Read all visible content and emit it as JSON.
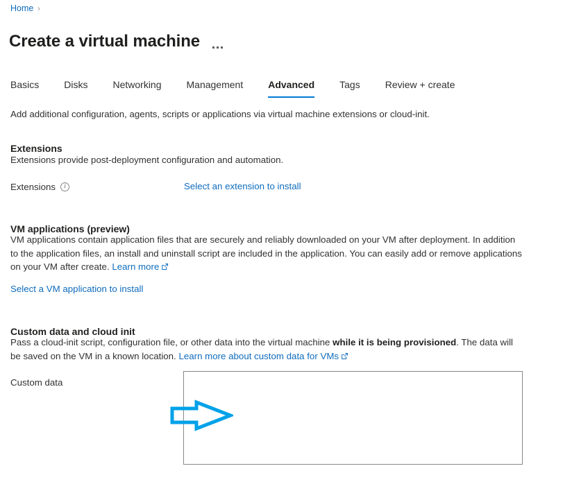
{
  "breadcrumb": {
    "home_label": "Home",
    "separator": "›"
  },
  "header": {
    "title": "Create a virtual machine",
    "more_menu_label": "..."
  },
  "tabs": [
    {
      "label": "Basics",
      "active": false
    },
    {
      "label": "Disks",
      "active": false
    },
    {
      "label": "Networking",
      "active": false
    },
    {
      "label": "Management",
      "active": false
    },
    {
      "label": "Advanced",
      "active": true
    },
    {
      "label": "Tags",
      "active": false
    },
    {
      "label": "Review + create",
      "active": false
    }
  ],
  "main": {
    "intro": "Add additional configuration, agents, scripts or applications via virtual machine extensions or cloud-init.",
    "extensions": {
      "heading": "Extensions",
      "description": "Extensions provide post-deployment configuration and automation.",
      "field_label": "Extensions",
      "info_glyph": "i",
      "select_link": "Select an extension to install"
    },
    "vm_applications": {
      "heading": "VM applications (preview)",
      "description_part1": "VM applications contain application files that are securely and reliably downloaded on your VM after deployment. In addition to the application files, an install and uninstall script are included in the application. You can easily add or remove applications on your VM after create. ",
      "learn_more_link": "Learn more",
      "select_link": "Select a VM application to install"
    },
    "custom_data": {
      "heading": "Custom data and cloud init",
      "description_part1": "Pass a cloud-init script, configuration file, or other data into the virtual machine ",
      "description_bold": "while it is being provisioned",
      "description_part2": ". The data will be saved on the VM in a known location. ",
      "learn_more_link": "Learn more about custom data for VMs",
      "field_label": "Custom data",
      "textarea_value": "",
      "textarea_placeholder": ""
    }
  },
  "annotation": {
    "arrow_color": "#00a2e8",
    "arrow_direction": "right"
  },
  "colors": {
    "link": "#0f6cbd",
    "accent": "#0078d4",
    "text": "#323130",
    "heading": "#201f1e",
    "border": "#8a8886",
    "annotation": "#00a2e8"
  }
}
